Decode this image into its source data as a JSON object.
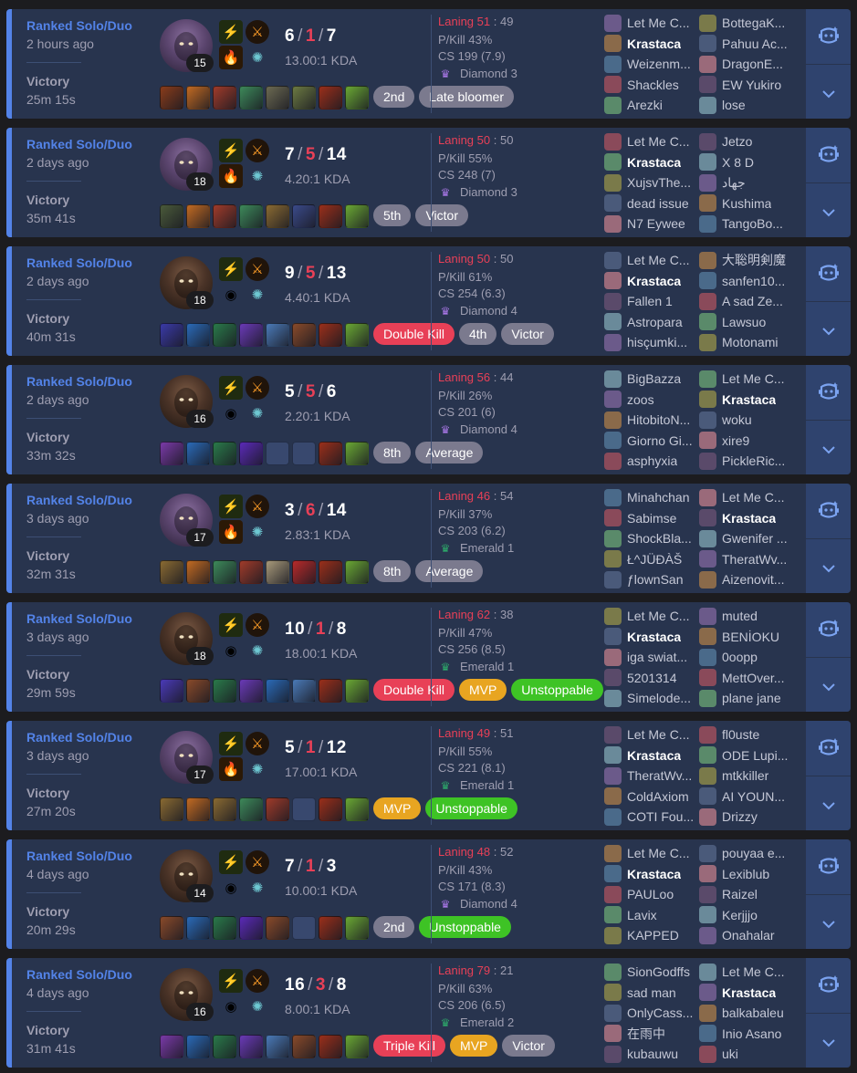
{
  "colors": {
    "background": "#1c1c1f",
    "card": "#28344e",
    "accent": "#5383e8",
    "loss_red": "#e84057",
    "side_panel": "#2f436e"
  },
  "matches": [
    {
      "mode": "Ranked Solo/Duo",
      "ago": "2 hours ago",
      "result": "Victory",
      "duration": "25m 15s",
      "champion_icon": "ekko-portrait",
      "level": "15",
      "spells": [
        "flash-icon",
        "ignite-icon"
      ],
      "runes": [
        "hail-of-blades-icon",
        "sorcery-icon"
      ],
      "kills": "6",
      "deaths": "1",
      "assists": "7",
      "kda_ratio": "13.00:1 KDA",
      "items": [
        "#8a3c1a",
        "#c26a22",
        "#a03b2a",
        "#3d8a5a",
        "#6c6a52",
        "#6c7a42",
        "#9b2f1a",
        "#6aa834"
      ],
      "tags": [
        {
          "label": "2nd",
          "color": "grey"
        },
        {
          "label": "Late bloomer",
          "color": "grey"
        }
      ],
      "laning_label": "Laning",
      "laning_a": "51",
      "laning_b": "49",
      "pkill": "P/Kill 43%",
      "cs": "CS 199 (7.9)",
      "rank_name": "Diamond 3",
      "rank_color": "#a877e6",
      "team1": [
        "Let Me C...",
        "Krastaca",
        "Weizenm...",
        "Shackles",
        "Arezki"
      ],
      "team2": [
        "BottegaK...",
        "Pahuu Ac...",
        "DragonE...",
        "EW Yukiro",
        "lose"
      ],
      "me_team": 1,
      "me_index": 1
    },
    {
      "mode": "Ranked Solo/Duo",
      "ago": "2 days ago",
      "result": "Victory",
      "duration": "35m 41s",
      "champion_icon": "ekko-portrait",
      "level": "18",
      "spells": [
        "flash-icon",
        "ignite-icon"
      ],
      "runes": [
        "hail-of-blades-icon",
        "sorcery-icon"
      ],
      "kills": "7",
      "deaths": "5",
      "assists": "14",
      "kda_ratio": "4.20:1 KDA",
      "items": [
        "#4a5a3a",
        "#c26a22",
        "#a03b2a",
        "#3d8a5a",
        "#8a6a32",
        "#3a4a8a",
        "#9b2f1a",
        "#6aa834"
      ],
      "tags": [
        {
          "label": "5th",
          "color": "grey"
        },
        {
          "label": "Victor",
          "color": "grey"
        }
      ],
      "laning_label": "Laning",
      "laning_a": "50",
      "laning_b": "50",
      "pkill": "P/Kill 55%",
      "cs": "CS 248 (7)",
      "rank_name": "Diamond 3",
      "rank_color": "#a877e6",
      "team1": [
        "Let Me C...",
        "Krastaca",
        "XujsvThe...",
        "dead issue",
        "N7 Eywee"
      ],
      "team2": [
        "Jetzo",
        "X 8 D",
        "جهاد",
        "Kushima",
        "TangoBo..."
      ],
      "me_team": 1,
      "me_index": 1
    },
    {
      "mode": "Ranked Solo/Duo",
      "ago": "2 days ago",
      "result": "Victory",
      "duration": "40m 31s",
      "champion_icon": "akshan-portrait",
      "level": "18",
      "spells": [
        "flash-icon",
        "electrocute-icon"
      ],
      "runes": [
        "hail-of-blades-icon",
        "sorcery-icon"
      ],
      "kills": "9",
      "deaths": "5",
      "assists": "13",
      "kda_ratio": "4.40:1 KDA",
      "items": [
        "#3a3aa8",
        "#2a6ab8",
        "#2a7a4a",
        "#6a3ab8",
        "#4a7ab8",
        "#8a4a2a",
        "#9b2f1a",
        "#6aa834"
      ],
      "tags": [
        {
          "label": "Double Kill",
          "color": "red"
        },
        {
          "label": "4th",
          "color": "grey"
        },
        {
          "label": "Victor",
          "color": "grey"
        }
      ],
      "laning_label": "Laning",
      "laning_a": "50",
      "laning_b": "50",
      "pkill": "P/Kill 61%",
      "cs": "CS 254 (6.3)",
      "rank_name": "Diamond 4",
      "rank_color": "#a877e6",
      "team1": [
        "Let Me C...",
        "Krastaca",
        "Fallen 1",
        "Astropara",
        "hisçumki..."
      ],
      "team2": [
        "大聡明剣魔",
        "sanfen10...",
        "A sad Ze...",
        "Lawsuo",
        "Motonami"
      ],
      "me_team": 1,
      "me_index": 1
    },
    {
      "mode": "Ranked Solo/Duo",
      "ago": "2 days ago",
      "result": "Victory",
      "duration": "33m 32s",
      "champion_icon": "akshan-portrait",
      "level": "16",
      "spells": [
        "flash-icon",
        "electrocute-icon"
      ],
      "runes": [
        "hail-of-blades-icon",
        "sorcery-icon"
      ],
      "kills": "5",
      "deaths": "5",
      "assists": "6",
      "kda_ratio": "2.20:1 KDA",
      "items": [
        "#7a3aa8",
        "#2a6ab8",
        "#2a7a4a",
        "#5a2ab8",
        "empty",
        "empty",
        "#9b2f1a",
        "#6aa834"
      ],
      "tags": [
        {
          "label": "8th",
          "color": "grey"
        },
        {
          "label": "Average",
          "color": "grey"
        }
      ],
      "laning_label": "Laning",
      "laning_a": "56",
      "laning_b": "44",
      "pkill": "P/Kill 26%",
      "cs": "CS 201 (6)",
      "rank_name": "Diamond 4",
      "rank_color": "#a877e6",
      "team1": [
        "BigBazza",
        "zoos",
        "HitobitoN...",
        "Giorno Gi...",
        "asphyxia"
      ],
      "team2": [
        "Let Me C...",
        "Krastaca",
        "woku",
        "xire9",
        "PickleRic..."
      ],
      "me_team": 2,
      "me_index": 1
    },
    {
      "mode": "Ranked Solo/Duo",
      "ago": "3 days ago",
      "result": "Victory",
      "duration": "32m 31s",
      "champion_icon": "ekko-portrait",
      "level": "17",
      "spells": [
        "flash-icon",
        "ignite-icon"
      ],
      "runes": [
        "hail-of-blades-icon",
        "sorcery-icon"
      ],
      "kills": "3",
      "deaths": "6",
      "assists": "14",
      "kda_ratio": "2.83:1 KDA",
      "items": [
        "#8a6a32",
        "#c26a22",
        "#3d8a5a",
        "#a03b2a",
        "#a89a7a",
        "#b82a2a",
        "#9b2f1a",
        "#6aa834"
      ],
      "tags": [
        {
          "label": "8th",
          "color": "grey"
        },
        {
          "label": "Average",
          "color": "grey"
        }
      ],
      "laning_label": "Laning",
      "laning_a": "46",
      "laning_b": "54",
      "pkill": "P/Kill 37%",
      "cs": "CS 203 (6.2)",
      "rank_name": "Emerald 1",
      "rank_color": "#2da86a",
      "team1": [
        "Minahchan",
        "Sabimse",
        "ShockBla...",
        "Ł^JÜÐÀŠ",
        "ƒlownSan"
      ],
      "team2": [
        "Let Me C...",
        "Krastaca",
        "Gwenifer ...",
        "TheratWv...",
        "Aizenovit..."
      ],
      "me_team": 2,
      "me_index": 1
    },
    {
      "mode": "Ranked Solo/Duo",
      "ago": "3 days ago",
      "result": "Victory",
      "duration": "29m 59s",
      "champion_icon": "akshan-portrait",
      "level": "18",
      "spells": [
        "flash-icon",
        "electrocute-icon"
      ],
      "runes": [
        "hail-of-blades-icon",
        "sorcery-icon"
      ],
      "kills": "10",
      "deaths": "1",
      "assists": "8",
      "kda_ratio": "18.00:1 KDA",
      "items": [
        "#4a3ab8",
        "#8a4a2a",
        "#2a7a4a",
        "#6a3ab8",
        "#2a6ab8",
        "#4a7ab8",
        "#9b2f1a",
        "#6aa834"
      ],
      "tags": [
        {
          "label": "Double Kill",
          "color": "red"
        },
        {
          "label": "MVP",
          "color": "orange"
        },
        {
          "label": "Unstoppable",
          "color": "green"
        }
      ],
      "laning_label": "Laning",
      "laning_a": "62",
      "laning_b": "38",
      "pkill": "P/Kill 47%",
      "cs": "CS 256 (8.5)",
      "rank_name": "Emerald 1",
      "rank_color": "#2da86a",
      "team1": [
        "Let Me C...",
        "Krastaca",
        "iga swiat...",
        "5201314",
        "Simelode..."
      ],
      "team2": [
        "muted",
        "BENİOKU",
        "0oopp",
        "MettOver...",
        "plane jane"
      ],
      "me_team": 1,
      "me_index": 1
    },
    {
      "mode": "Ranked Solo/Duo",
      "ago": "3 days ago",
      "result": "Victory",
      "duration": "27m 20s",
      "champion_icon": "ekko-portrait",
      "level": "17",
      "spells": [
        "flash-icon",
        "ignite-icon"
      ],
      "runes": [
        "hail-of-blades-icon",
        "sorcery-icon"
      ],
      "kills": "5",
      "deaths": "1",
      "assists": "12",
      "kda_ratio": "17.00:1 KDA",
      "items": [
        "#8a6a32",
        "#c26a22",
        "#8a6a32",
        "#3d8a5a",
        "#a03b2a",
        "empty",
        "#9b2f1a",
        "#6aa834"
      ],
      "tags": [
        {
          "label": "MVP",
          "color": "orange"
        },
        {
          "label": "Unstoppable",
          "color": "green"
        }
      ],
      "laning_label": "Laning",
      "laning_a": "49",
      "laning_b": "51",
      "pkill": "P/Kill 55%",
      "cs": "CS 221 (8.1)",
      "rank_name": "Emerald 1",
      "rank_color": "#2da86a",
      "team1": [
        "Let Me C...",
        "Krastaca",
        "TheratWv...",
        "ColdAxiom",
        "COTI Fou..."
      ],
      "team2": [
        "fl0uste",
        "ODE Lupi...",
        "mtkkiller",
        "AI YOUN...",
        "Drizzy"
      ],
      "me_team": 1,
      "me_index": 1
    },
    {
      "mode": "Ranked Solo/Duo",
      "ago": "4 days ago",
      "result": "Victory",
      "duration": "20m 29s",
      "champion_icon": "akshan-portrait",
      "level": "14",
      "spells": [
        "flash-icon",
        "electrocute-icon"
      ],
      "runes": [
        "hail-of-blades-icon",
        "sorcery-icon"
      ],
      "kills": "7",
      "deaths": "1",
      "assists": "3",
      "kda_ratio": "10.00:1 KDA",
      "items": [
        "#8a4a2a",
        "#2a6ab8",
        "#2a7a4a",
        "#5a2ab8",
        "#8a4a2a",
        "empty",
        "#9b2f1a",
        "#6aa834"
      ],
      "tags": [
        {
          "label": "2nd",
          "color": "grey"
        },
        {
          "label": "Unstoppable",
          "color": "green"
        }
      ],
      "laning_label": "Laning",
      "laning_a": "48",
      "laning_b": "52",
      "pkill": "P/Kill 43%",
      "cs": "CS 171 (8.3)",
      "rank_name": "Diamond 4",
      "rank_color": "#a877e6",
      "team1": [
        "Let Me C...",
        "Krastaca",
        "PAULoo",
        "Lavix",
        "KAPPED"
      ],
      "team2": [
        "pouyaa e...",
        "Lexiblub",
        "Raizel",
        "Kerjjjo",
        "Onahalar"
      ],
      "me_team": 1,
      "me_index": 1
    },
    {
      "mode": "Ranked Solo/Duo",
      "ago": "4 days ago",
      "result": "Victory",
      "duration": "31m 41s",
      "champion_icon": "akshan-portrait",
      "level": "16",
      "spells": [
        "flash-icon",
        "electrocute-icon"
      ],
      "runes": [
        "hail-of-blades-icon",
        "sorcery-icon"
      ],
      "kills": "16",
      "deaths": "3",
      "assists": "8",
      "kda_ratio": "8.00:1 KDA",
      "items": [
        "#7a3aa8",
        "#2a6ab8",
        "#2a7a4a",
        "#6a3ab8",
        "#4a7ab8",
        "#8a4a2a",
        "#9b2f1a",
        "#6aa834"
      ],
      "tags": [
        {
          "label": "Triple Kill",
          "color": "red"
        },
        {
          "label": "MVP",
          "color": "orange"
        },
        {
          "label": "Victor",
          "color": "grey"
        }
      ],
      "laning_label": "Laning",
      "laning_a": "79",
      "laning_b": "21",
      "pkill": "P/Kill 63%",
      "cs": "CS 206 (6.5)",
      "rank_name": "Emerald 2",
      "rank_color": "#2da86a",
      "team1": [
        "SionGodffs",
        "sad man",
        "OnlyCass...",
        "在雨中",
        "kubauwu"
      ],
      "team2": [
        "Let Me C...",
        "Krastaca",
        "balkabaleu",
        "Inio Asano",
        "uki"
      ],
      "me_team": 2,
      "me_index": 1
    }
  ]
}
